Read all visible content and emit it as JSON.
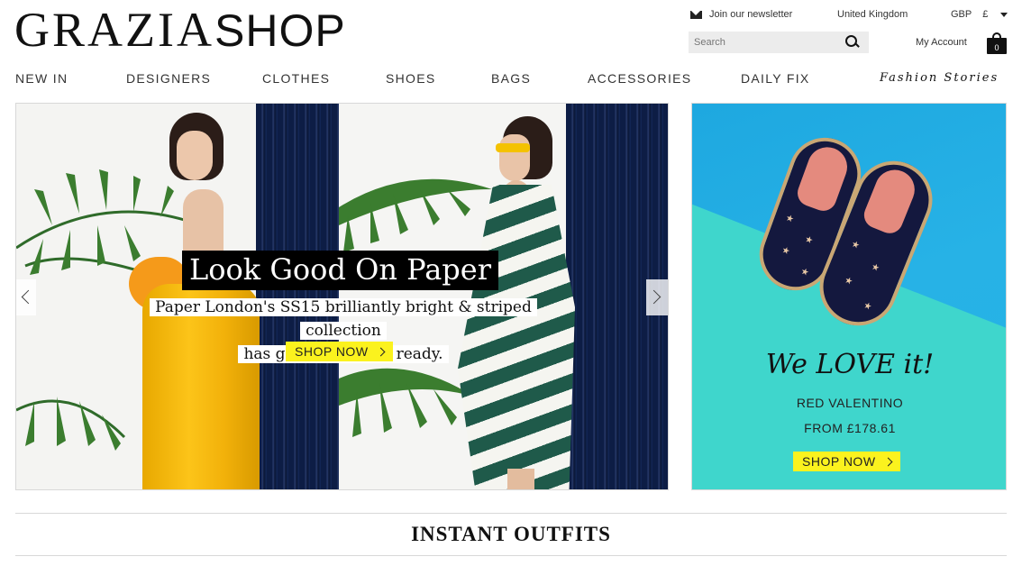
{
  "header": {
    "logo_bold": "GRAZIA",
    "logo_light": "SHOP",
    "newsletter_label": "Join our newsletter",
    "country": "United Kingdom",
    "currency_code": "GBP",
    "currency_symbol": "£",
    "search_placeholder": "Search",
    "account_label": "My Account",
    "bag_count": "0"
  },
  "nav": {
    "items": [
      {
        "label": "NEW IN"
      },
      {
        "label": "DESIGNERS"
      },
      {
        "label": "CLOTHES"
      },
      {
        "label": "SHOES"
      },
      {
        "label": "BAGS"
      },
      {
        "label": "ACCESSORIES"
      },
      {
        "label": "DAILY FIX"
      }
    ],
    "fashion_stories": "Fashion Stories"
  },
  "hero": {
    "title": "Look Good On Paper",
    "subtitle_line1": "Paper London's SS15 brilliantly bright & striped collection",
    "subtitle_line2": "has got us summer ready.",
    "cta": "SHOP NOW"
  },
  "promo": {
    "title": "We LOVE it!",
    "brand": "RED VALENTINO",
    "price": "FROM £178.61",
    "cta": "SHOP NOW"
  },
  "section": {
    "title": "INSTANT OUTFITS"
  },
  "colors": {
    "cta_yellow": "#fbf21e",
    "promo_blue": "#1ea8e0",
    "promo_teal": "#3fd6cc",
    "navy_stripes": "#0d1d45"
  }
}
